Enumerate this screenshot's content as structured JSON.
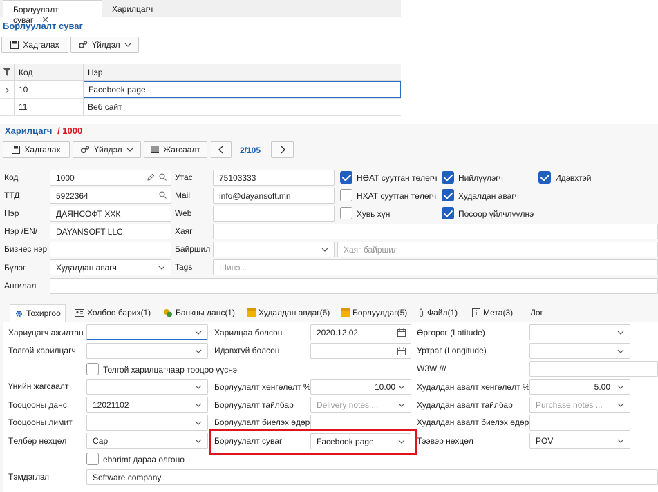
{
  "top_tabs": [
    {
      "label": "Борлуулалт суваг",
      "active": true
    },
    {
      "label": "Харилцагч",
      "active": false
    }
  ],
  "channel_panel": {
    "title": "Борлуулалт суваг",
    "save_label": "Хадгалах",
    "action_label": "Үйлдэл",
    "columns": [
      "Код",
      "Нэр"
    ],
    "rows": [
      {
        "code": "10",
        "name": "Facebook page"
      },
      {
        "code": "11",
        "name": "Веб сайт"
      }
    ]
  },
  "customer": {
    "title": "Харилцагч",
    "record_no": "/ 1000",
    "save_label": "Хадгалах",
    "action_label": "Үйлдэл",
    "list_label": "Жагсаалт",
    "pager": "2/105",
    "fields": {
      "code_label": "Код",
      "code": "1000",
      "ttd_label": "ТТД",
      "ttd": "5922364",
      "name_label": "Нэр",
      "name": "ДАЯНСОФТ ХХК",
      "name_en_label": "Нэр /EN/",
      "name_en": "DAYANSOFT LLC",
      "biz_name_label": "Бизнес нэр",
      "biz_name": "",
      "group_label": "Бүлэг",
      "group": "Худалдан авагч",
      "category_label": "Ангилал",
      "category": "",
      "phone_label": "Утас",
      "phone": "75103333",
      "mail_label": "Mail",
      "mail": "info@dayansoft.mn",
      "web_label": "Web",
      "web": "",
      "address_label": "Хаяг",
      "address": "",
      "location_label": "Байршил",
      "location": "",
      "location_placeholder": "Хаяг байршил",
      "tags_label": "Tags",
      "tags_placeholder": "Шинэ..."
    },
    "checks": [
      {
        "label": "НӨАТ суутган төлөгч",
        "checked": true
      },
      {
        "label": "НХАТ суутган төлөгч",
        "checked": false
      },
      {
        "label": "Хувь хүн",
        "checked": false
      },
      {
        "label": "Нийлүүлэгч",
        "checked": true
      },
      {
        "label": "Худалдан авагч",
        "checked": true
      },
      {
        "label": "Посоор үйлчлүүлнэ",
        "checked": true
      },
      {
        "label": "Идэвхтэй",
        "checked": true
      }
    ],
    "detail_tabs": [
      {
        "label": "Тохиргоо",
        "icon": "gear-icon"
      },
      {
        "label": "Холбоо барих(1)",
        "icon": "contact-card-icon"
      },
      {
        "label": "Банкны данс(1)",
        "icon": "coins-icon"
      },
      {
        "label": "Худалдан авдаг(6)",
        "icon": "box-icon"
      },
      {
        "label": "Борлуулдаг(5)",
        "icon": "box-icon"
      },
      {
        "label": "Файл(1)",
        "icon": "paperclip-icon"
      },
      {
        "label": "Мета(3)",
        "icon": "info-icon"
      },
      {
        "label": "Лог",
        "icon": ""
      }
    ],
    "settings": {
      "responsible_label": "Хариуцагч ажилтан",
      "responsible": "",
      "head_label": "Толгой харилцагч",
      "head": "",
      "head_calc_label": "Толгой харилцагчаар тооцоо үүснэ",
      "price_list_label": "Үнийн жагсаалт",
      "price_list": "",
      "account_label": "Тооцооны данс",
      "account": "12021102",
      "limit_label": "Тооцооны лимит",
      "limit": "",
      "payment_label": "Төлбөр нөхцөл",
      "payment": "Сар",
      "ebarimt_label": "ebarimt дараа олгоно",
      "note_label": "Тэмдэглэл",
      "note": "Software company",
      "start_label": "Харилцаа болсон",
      "start": "2020.12.02",
      "inactive_label": "Идэвхгүй болсон",
      "inactive": "",
      "sale_discount_label": "Борлуулалт хөнгөлөлт %",
      "sale_discount": "10.00",
      "sale_note_label": "Борлуулалт тайлбар",
      "sale_note_placeholder": "Delivery notes ...",
      "sale_doc_label": "Борлуулалт биелэх өдөр",
      "sale_doc": "",
      "channel_label": "Борлуулалт суваг",
      "channel": "Facebook page",
      "lat_label": "Өргөрөг (Latitude)",
      "lat": "",
      "lng_label": "Уртраг (Longitude)",
      "lng": "",
      "w3w_label": "W3W ///",
      "w3w": "",
      "buy_discount_label": "Худалдан авалт хөнгөлөлт %",
      "buy_discount": "5.00",
      "buy_note_label": "Худалдан авалт тайлбар",
      "buy_note_placeholder": "Purchase notes ...",
      "buy_doc_label": "Худалдан авалт биелэх өдөр",
      "buy_doc": "",
      "delivery_label": "Тээвэр нөхцөл",
      "delivery": "POV"
    }
  },
  "colors": {
    "accent": "#1a5ea8",
    "highlight": "#e0141e",
    "check": "#1f5fbf"
  }
}
